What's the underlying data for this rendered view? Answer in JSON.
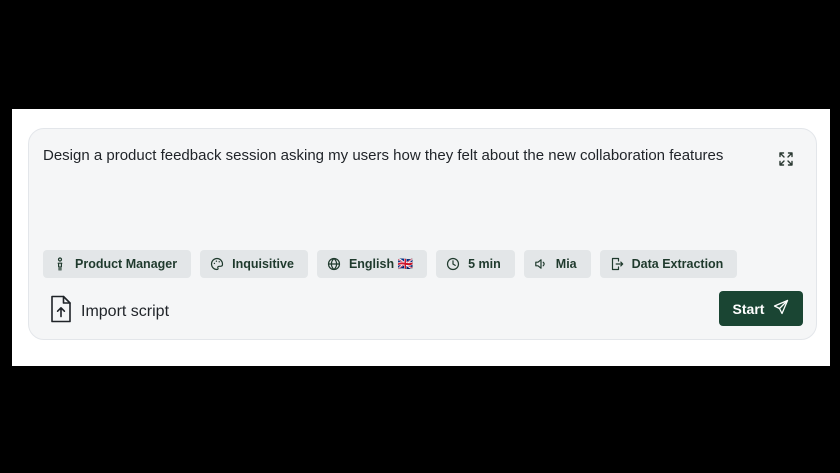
{
  "prompt": {
    "text": "Design a product feedback session asking my users how they felt about the new collaboration features"
  },
  "chips": {
    "role": {
      "label": "Product Manager",
      "icon": "person-icon"
    },
    "tone": {
      "label": "Inquisitive",
      "icon": "palette-icon"
    },
    "language": {
      "label": "English 🇬🇧",
      "icon": "globe-icon"
    },
    "duration": {
      "label": "5 min",
      "icon": "clock-icon"
    },
    "voice": {
      "label": "Mia",
      "icon": "speaker-icon"
    },
    "output": {
      "label": "Data Extraction",
      "icon": "export-icon"
    }
  },
  "import": {
    "label": "Import script",
    "icon": "file-upload-icon"
  },
  "start": {
    "label": "Start",
    "icon": "send-icon"
  },
  "colors": {
    "accent": "#1a4533",
    "chip_bg": "#e3e6e8",
    "chip_text": "#1f3a2d",
    "card_bg": "#f5f6f7"
  }
}
